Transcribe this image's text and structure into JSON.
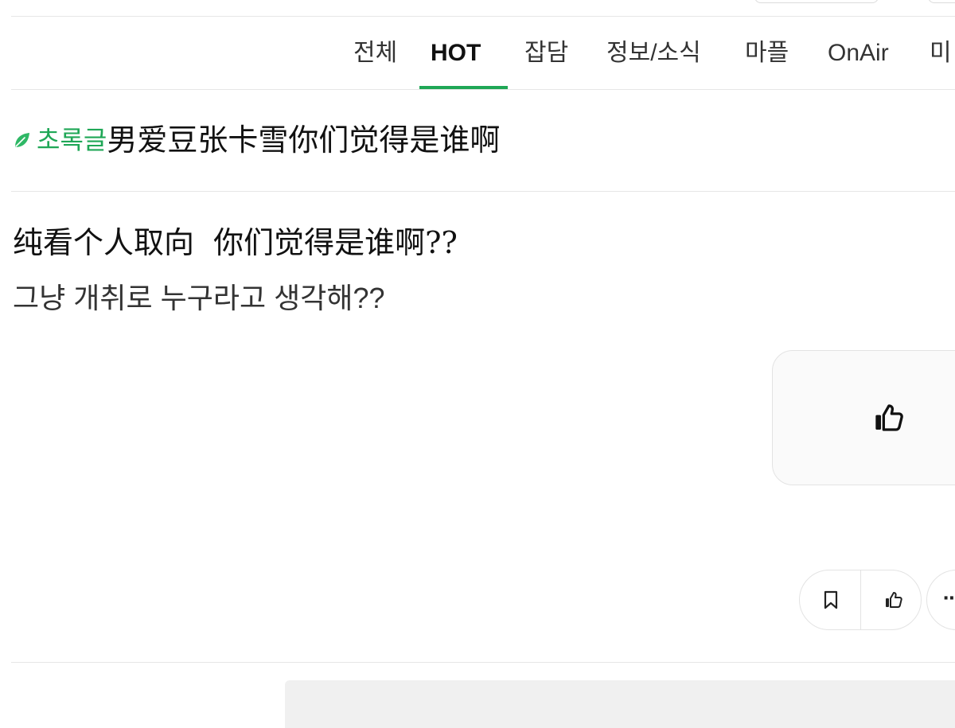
{
  "nav": {
    "tabs": [
      {
        "label": "전체",
        "active": false
      },
      {
        "label": "HOT",
        "active": true
      },
      {
        "label": "잡담",
        "active": false
      },
      {
        "label": "정보/소식",
        "active": false
      },
      {
        "label": "마플",
        "active": false
      },
      {
        "label": "OnAir",
        "active": false
      },
      {
        "label": "미",
        "active": false
      }
    ]
  },
  "post": {
    "category": "초록글",
    "title": "男爱豆张卡雪你们觉得是谁啊",
    "body_line_1": "纯看个人取向  你们觉得是谁啊??",
    "body_line_2": "그냥 개취로 누구라고 생각해??"
  },
  "icons": {
    "category": "leaf-icon",
    "like": "thumbs-up-icon",
    "bookmark": "bookmark-icon",
    "more": "more-icon"
  },
  "actions": {
    "more_label": "⋯"
  },
  "colors": {
    "accent": "#1fa756",
    "border": "#e3e3e3",
    "panel": "#f0f0f0"
  }
}
